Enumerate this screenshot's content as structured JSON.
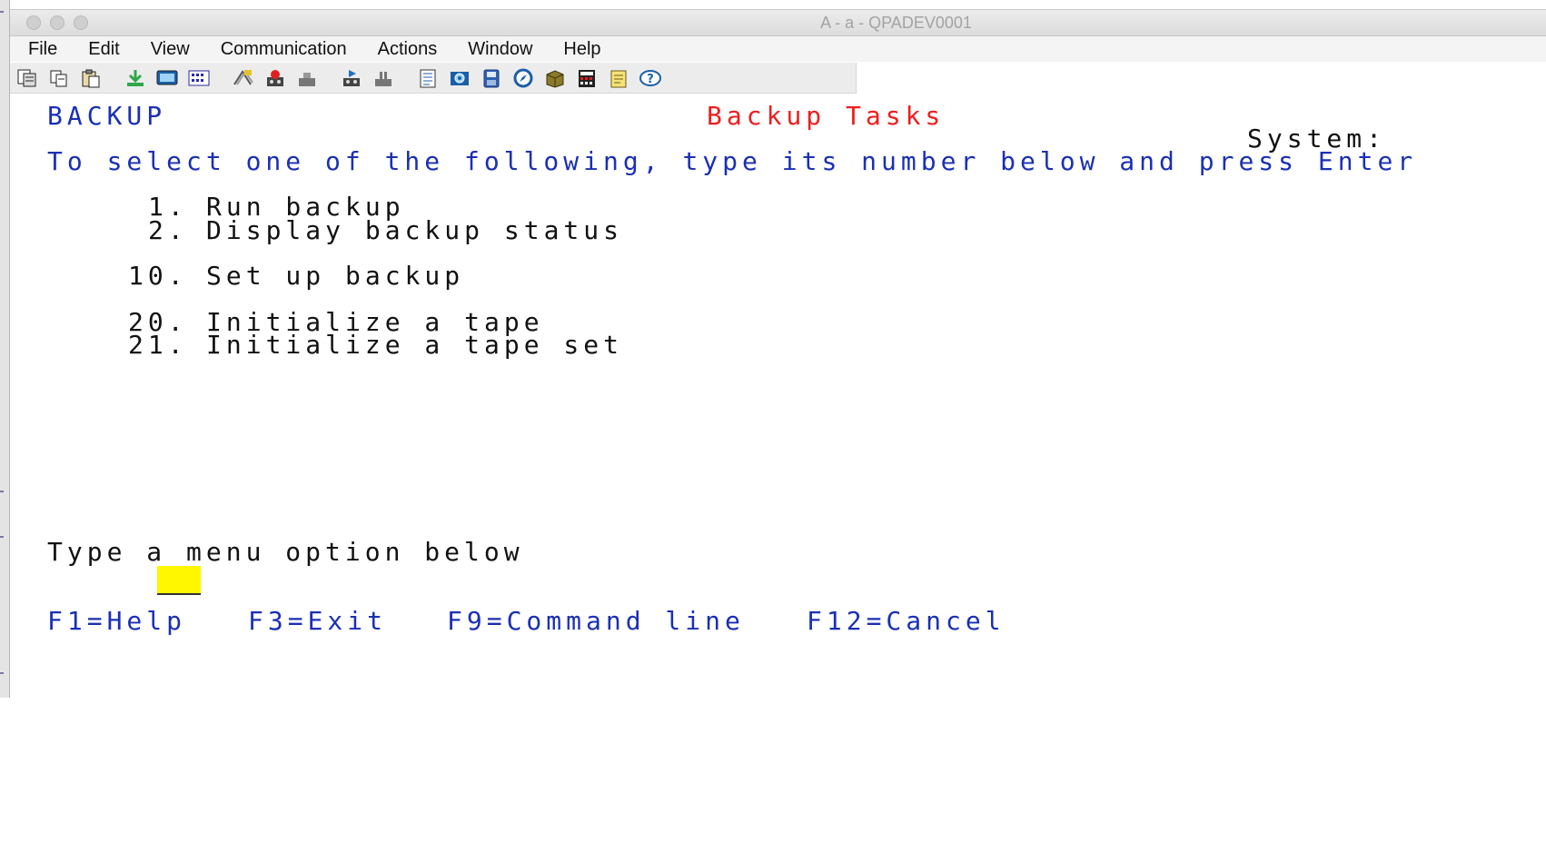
{
  "window": {
    "title": "A - a - QPADEV0001"
  },
  "menu": [
    "File",
    "Edit",
    "View",
    "Communication",
    "Actions",
    "Window",
    "Help"
  ],
  "toolbar_icons": [
    "copy-screen-icon",
    "copy-icon",
    "paste-icon",
    "receive-file-icon",
    "display-icon",
    "keypad-icon",
    "macro-icon",
    "record-macro-icon",
    "stop-macro-icon",
    "play-macro-icon",
    "pause-macro-icon",
    "document-icon",
    "settings-icon",
    "save-icon",
    "compass-icon",
    "package-icon",
    "calculator-icon",
    "notes-icon",
    "help-icon"
  ],
  "screen": {
    "menu_id": "BACKUP",
    "title": "Backup Tasks",
    "system_label": "System:",
    "instruction": "To select one of the following, type its number below and press Enter",
    "options": [
      {
        "number": "1.",
        "label": "Run backup"
      },
      {
        "number": "2.",
        "label": "Display backup status"
      },
      {
        "number": "10.",
        "label": "Set up backup"
      },
      {
        "number": "20.",
        "label": "Initialize a tape"
      },
      {
        "number": "21.",
        "label": "Initialize a tape set"
      }
    ],
    "prompt": "Type a menu option below",
    "input_value": "",
    "function_keys": [
      "F1=Help",
      "F3=Exit",
      "F9=Command line",
      "F12=Cancel"
    ]
  },
  "colors": {
    "text_blue": "#1a2fb5",
    "title_red": "#ef1d1d",
    "input_yellow": "#fff700"
  }
}
